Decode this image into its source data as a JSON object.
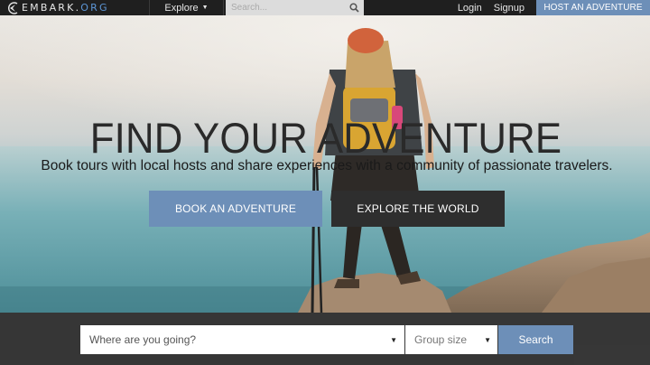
{
  "navbar": {
    "brand_prefix": "EMBARK.",
    "brand_suffix": "ORG",
    "explore_label": "Explore",
    "search_placeholder": "Search...",
    "login_label": "Login",
    "signup_label": "Signup",
    "host_label": "HOST AN ADVENTURE"
  },
  "hero": {
    "title": "FIND YOUR ADVENTURE",
    "subtitle": "Book tours with local hosts and share experiences with a community of passionate travelers.",
    "book_label": "BOOK AN ADVENTURE",
    "explore_label": "EXPLORE THE WORLD"
  },
  "search_bar": {
    "destination_placeholder": "Where are you going?",
    "group_size_placeholder": "Group size",
    "search_label": "Search"
  },
  "colors": {
    "accent": "#6d8fb8",
    "dark": "#2e2e2e",
    "brand_org": "#5d96d6"
  },
  "icons": [
    "compass-logo-icon",
    "caret-down-icon",
    "search-icon",
    "dropdown-arrow-icon"
  ]
}
